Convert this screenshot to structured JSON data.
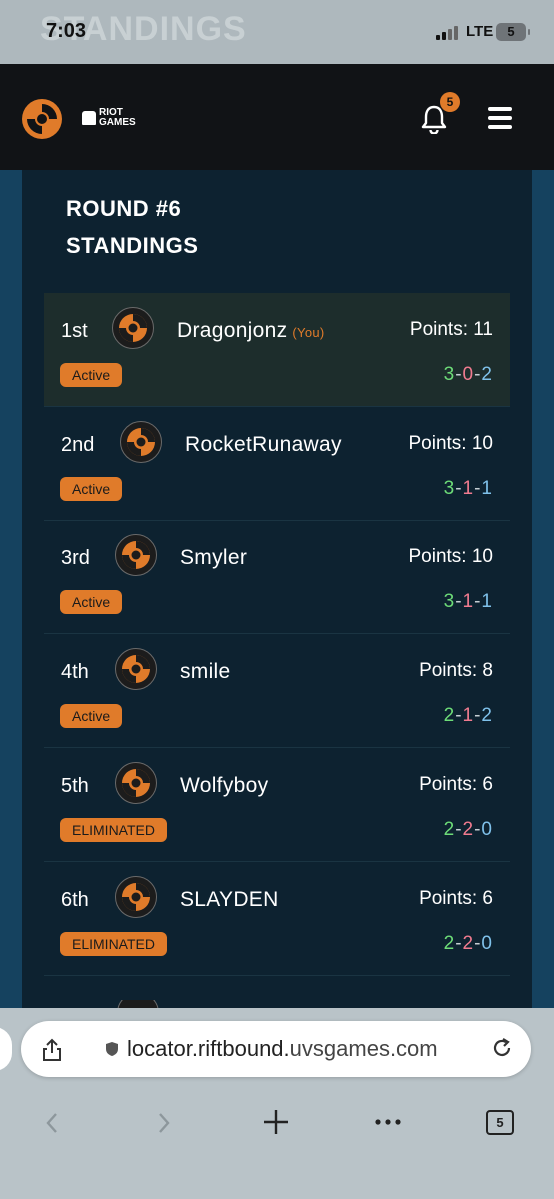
{
  "status_bar": {
    "time": "7:03",
    "network": "LTE",
    "battery": "5",
    "ghost_text": "STANDINGS"
  },
  "header": {
    "brand": "RIOT GAMES",
    "brand_line1": "RIOT",
    "brand_line2": "GAMES",
    "notification_count": "5",
    "accent_color": "#e07b2a"
  },
  "page": {
    "title_line1": "ROUND #6",
    "title_line2": "STANDINGS"
  },
  "standings": [
    {
      "rank": "1st",
      "name": "Dragonjonz",
      "you": "(You)",
      "points": "Points: 11",
      "wins": "3",
      "losses": "0",
      "draws": "2",
      "status": "Active"
    },
    {
      "rank": "2nd",
      "name": "RocketRunaway",
      "you": "",
      "points": "Points: 10",
      "wins": "3",
      "losses": "1",
      "draws": "1",
      "status": "Active"
    },
    {
      "rank": "3rd",
      "name": "Smyler",
      "you": "",
      "points": "Points: 10",
      "wins": "3",
      "losses": "1",
      "draws": "1",
      "status": "Active"
    },
    {
      "rank": "4th",
      "name": "smile",
      "you": "",
      "points": "Points: 8",
      "wins": "2",
      "losses": "1",
      "draws": "2",
      "status": "Active"
    },
    {
      "rank": "5th",
      "name": "Wolfyboy",
      "you": "",
      "points": "Points: 6",
      "wins": "2",
      "losses": "2",
      "draws": "0",
      "status": "ELIMINATED"
    },
    {
      "rank": "6th",
      "name": "SLAYDEN",
      "you": "",
      "points": "Points: 6",
      "wins": "2",
      "losses": "2",
      "draws": "0",
      "status": "ELIMINATED"
    }
  ],
  "record_separator": "-",
  "browser": {
    "url_domain_a": "locator.riftbound.",
    "url_domain_b": "uvsgames.com",
    "tab_count": "5"
  },
  "icons": [
    "signal-icon",
    "battery-icon",
    "app-logo-icon",
    "riot-fist-icon",
    "bell-icon",
    "hamburger-menu-icon",
    "player-avatar-icon",
    "share-icon",
    "shield-icon",
    "reload-icon",
    "back-icon",
    "forward-icon",
    "new-tab-icon",
    "more-icon",
    "tabs-icon"
  ]
}
